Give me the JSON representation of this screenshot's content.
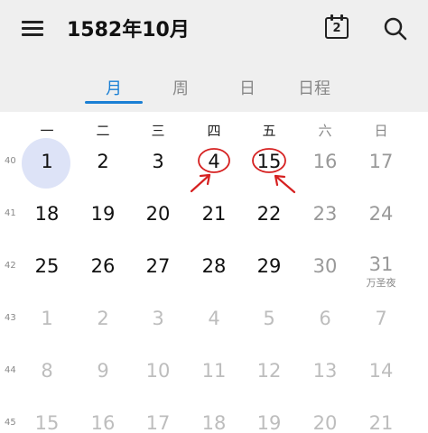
{
  "header": {
    "title": "1582年10月",
    "today_button_day": "2"
  },
  "tabs": [
    {
      "label": "月",
      "active": true
    },
    {
      "label": "周",
      "active": false
    },
    {
      "label": "日",
      "active": false
    },
    {
      "label": "日程",
      "active": false
    }
  ],
  "weekdays": [
    "一",
    "二",
    "三",
    "四",
    "五",
    "六",
    "日"
  ],
  "weeks": [
    {
      "number": "40",
      "days": [
        "1",
        "2",
        "3",
        "4",
        "15",
        "16",
        "17"
      ]
    },
    {
      "number": "41",
      "days": [
        "18",
        "19",
        "20",
        "21",
        "22",
        "23",
        "24"
      ]
    },
    {
      "number": "42",
      "days": [
        "25",
        "26",
        "27",
        "28",
        "29",
        "30",
        "31"
      ]
    },
    {
      "number": "43",
      "days": [
        "1",
        "2",
        "3",
        "4",
        "5",
        "6",
        "7"
      ]
    },
    {
      "number": "44",
      "days": [
        "8",
        "9",
        "10",
        "11",
        "12",
        "13",
        "14"
      ]
    },
    {
      "number": "45",
      "days": [
        "15",
        "16",
        "17",
        "18",
        "19",
        "20",
        "21"
      ]
    }
  ],
  "festival": {
    "label": "万圣夜"
  },
  "selected_day": "1",
  "highlighted_days": [
    "4",
    "15"
  ],
  "colors": {
    "accent": "#1a7fd4",
    "annotation_red": "#d62020",
    "today_circle": "#dde3f7"
  }
}
